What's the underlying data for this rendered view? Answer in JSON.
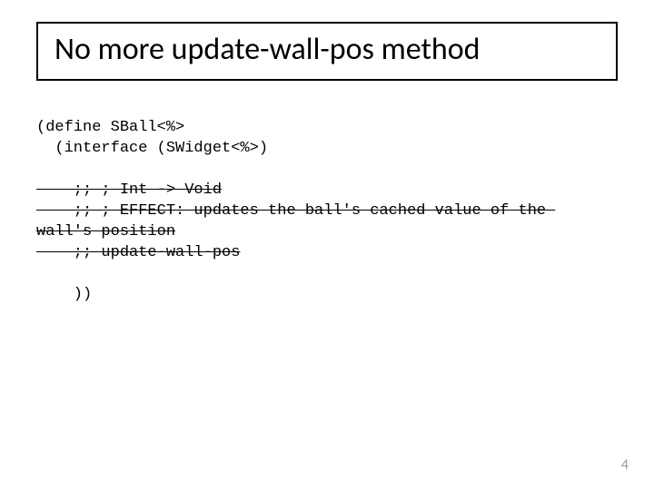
{
  "title": "No more update-wall-pos method",
  "code": {
    "line1": "(define SBall<%>",
    "line2": "  (interface (SWidget<%>)",
    "blank1": "",
    "s1": "    ;; ; Int -> Void",
    "s2": "    ;; ; EFFECT: updates the ball's cached value of the ",
    "s3": "wall's position",
    "s4": "    ;; update-wall-pos",
    "blank2": "",
    "line3": "    ))"
  },
  "page_number": "4"
}
